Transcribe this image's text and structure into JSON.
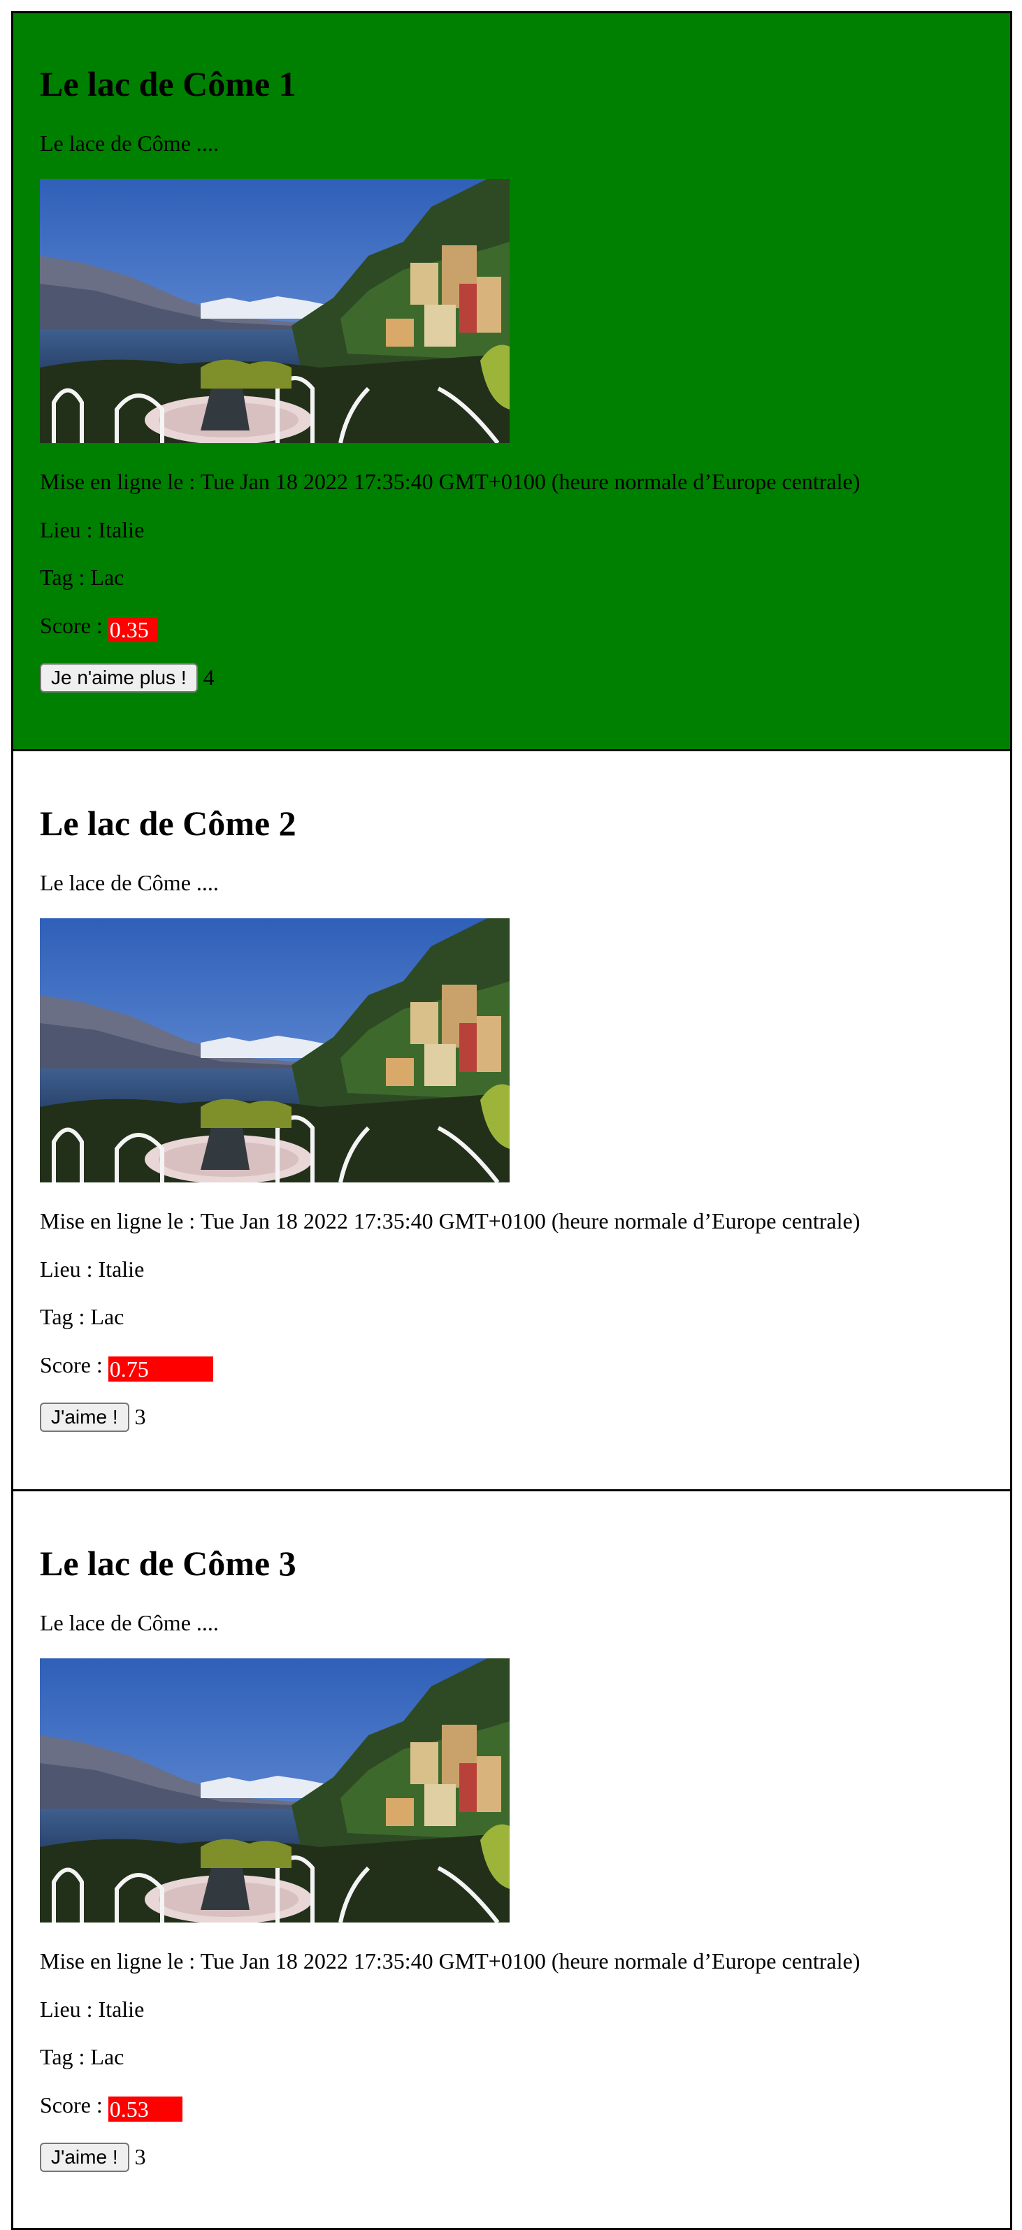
{
  "labels": {
    "posted_prefix": "Mise en ligne le : ",
    "location_prefix": "Lieu : ",
    "tag_prefix": "Tag : ",
    "score_prefix": "Score : "
  },
  "colors": {
    "liked_card_background": "#008000",
    "score_bar": "#ff0000",
    "page_background": "#ffffff"
  },
  "posts": [
    {
      "title": "Le lac de Côme 1",
      "description": "Le lace de Côme ....",
      "image_icon": "lake-como-photo",
      "posted": "Tue Jan 18 2022 17:35:40 GMT+0100 (heure normale d’Europe centrale)",
      "location": "Italie",
      "tag": "Lac",
      "score": "0.35",
      "score_fraction": 0.35,
      "button_label": "Je n'aime plus !",
      "likes": "4",
      "liked": true
    },
    {
      "title": "Le lac de Côme 2",
      "description": "Le lace de Côme ....",
      "image_icon": "lake-como-photo",
      "posted": "Tue Jan 18 2022 17:35:40 GMT+0100 (heure normale d’Europe centrale)",
      "location": "Italie",
      "tag": "Lac",
      "score": "0.75",
      "score_fraction": 0.75,
      "button_label": "J'aime !",
      "likes": "3",
      "liked": false
    },
    {
      "title": "Le lac de Côme 3",
      "description": "Le lace de Côme ....",
      "image_icon": "lake-como-photo",
      "posted": "Tue Jan 18 2022 17:35:40 GMT+0100 (heure normale d’Europe centrale)",
      "location": "Italie",
      "tag": "Lac",
      "score": "0.53",
      "score_fraction": 0.53,
      "button_label": "J'aime !",
      "likes": "3",
      "liked": false
    }
  ]
}
